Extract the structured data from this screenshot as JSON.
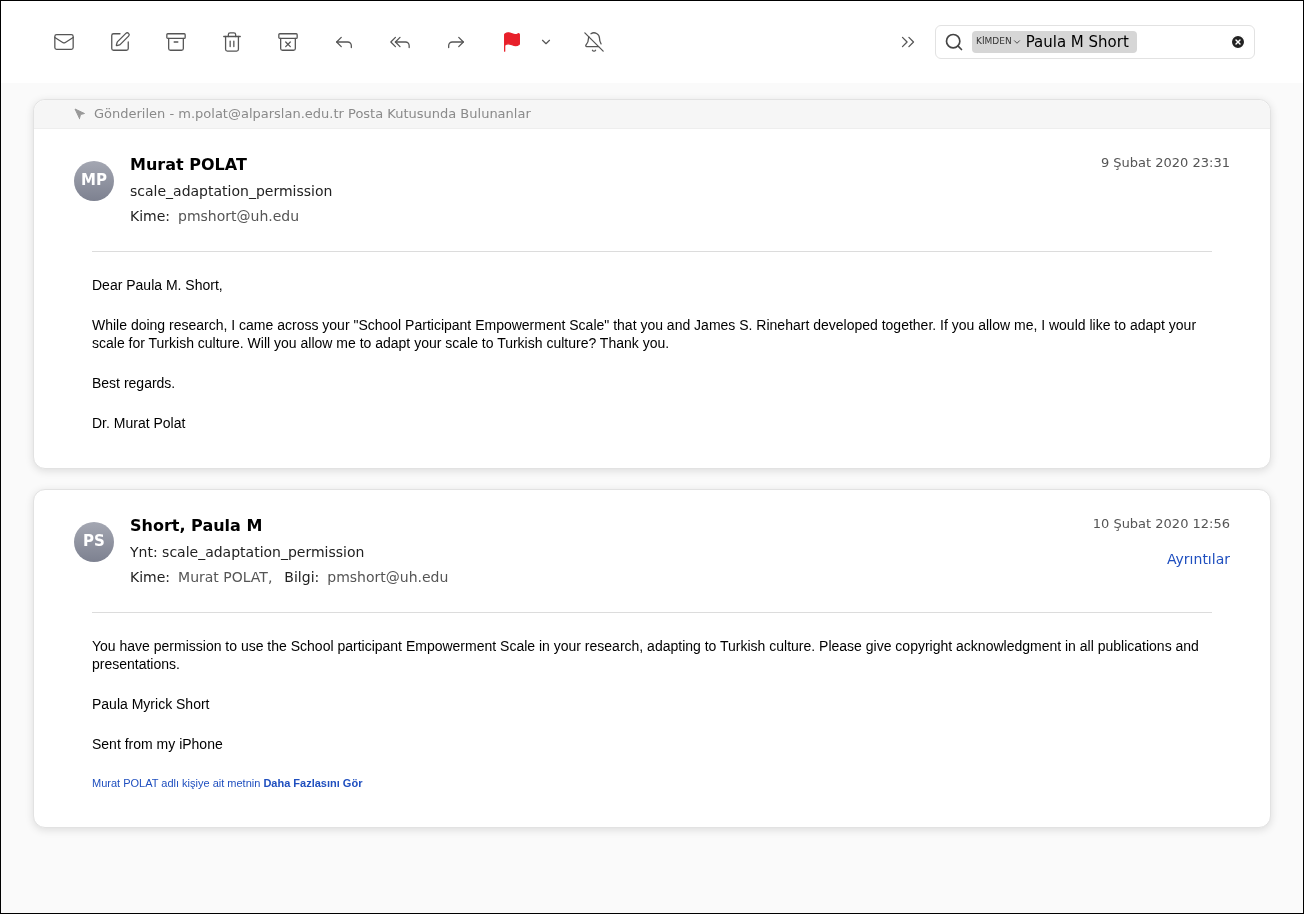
{
  "search": {
    "token": "KİMDEN",
    "value": "Paula M Short"
  },
  "mailbox_banner": "Gönderilen - m.polat@alparslan.edu.tr Posta Kutusunda Bulunanlar",
  "messages": [
    {
      "initials": "MP",
      "sender": "Murat POLAT",
      "subject": "scale_adaptation_permission",
      "recipients": [
        {
          "label": "Kime:",
          "value": "pmshort@uh.edu"
        }
      ],
      "date": "9 Şubat 2020 23:31",
      "body": [
        "Dear Paula M. Short,",
        "While doing research, I came across your \"School Participant Empowerment Scale\" that you and James S. Rinehart developed together. If you allow me, I would like to adapt your scale for Turkish culture. Will you allow me to adapt your scale to Turkish culture? Thank you.",
        "Best regards.",
        "Dr. Murat Polat"
      ]
    },
    {
      "initials": "PS",
      "sender": "Short, Paula M",
      "subject": "Ynt: scale_adaptation_permission",
      "recipients": [
        {
          "label": "Kime:",
          "value": "Murat POLAT,"
        },
        {
          "label": "Bilgi:",
          "value": "pmshort@uh.edu"
        }
      ],
      "date": "10 Şubat 2020 12:56",
      "details_link": "Ayrıntılar",
      "body": [
        "You have permission to use the School participant Empowerment Scale in your research, adapting to Turkish culture.  Please give copyright acknowledgment in all publications and presentations.",
        "Paula Myrick Short",
        "Sent from my iPhone"
      ],
      "more_link": "Murat POLAT adlı kişiye ait metnin **Daha Fazlasını Gör**"
    }
  ]
}
